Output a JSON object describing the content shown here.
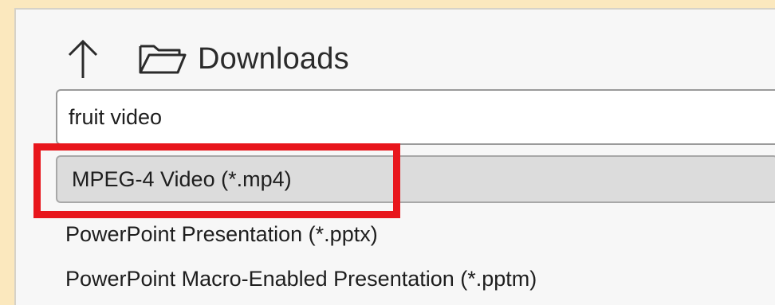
{
  "navigation": {
    "up_icon": "arrow-up-icon",
    "folder_icon": "folder-icon",
    "current_folder": "Downloads"
  },
  "file_name_input": {
    "value": "fruit video"
  },
  "save_as_type": {
    "options": [
      {
        "label": "MPEG-4 Video (*.mp4)",
        "selected": true
      },
      {
        "label": "PowerPoint Presentation (*.pptx)",
        "selected": false
      },
      {
        "label": "PowerPoint Macro-Enabled Presentation (*.pptm)",
        "selected": false
      }
    ]
  },
  "annotation": {
    "highlight_color": "#e8161c"
  },
  "colors": {
    "page_background": "#fbe8be",
    "panel_background": "#f7f7f7",
    "selected_option_background": "#dcdcdc"
  }
}
